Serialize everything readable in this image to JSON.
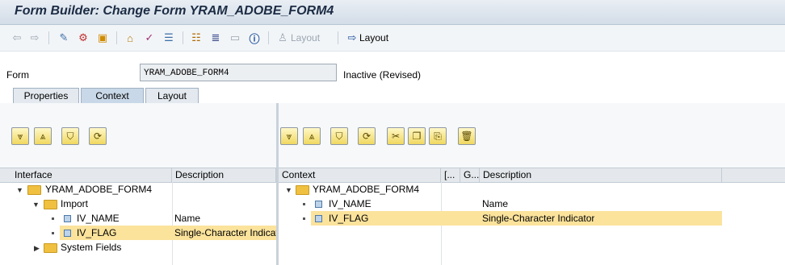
{
  "window": {
    "title": "Form Builder: Change Form YRAM_ADOBE_FORM4"
  },
  "toolbar": {
    "back_icon": "back-arrow-icon",
    "forward_icon": "forward-arrow-icon",
    "layout_disabled_label": "Layout",
    "layout_label": "Layout"
  },
  "form": {
    "label": "Form",
    "value": "YRAM_ADOBE_FORM4",
    "status": "Inactive (Revised)"
  },
  "tabs": [
    {
      "label": "Properties"
    },
    {
      "label": "Context"
    },
    {
      "label": "Layout"
    }
  ],
  "interface_tree": {
    "headers": {
      "name": "Interface",
      "description": "Description"
    },
    "rows": [
      {
        "name": "YRAM_ADOBE_FORM4",
        "description": ""
      },
      {
        "name": "Import",
        "description": ""
      },
      {
        "name": "IV_NAME",
        "description": "Name"
      },
      {
        "name": "IV_FLAG",
        "description": "Single-Character Indicat"
      },
      {
        "name": "System Fields",
        "description": ""
      }
    ]
  },
  "context_tree": {
    "headers": {
      "name": "Context",
      "col2": "[...",
      "col3": "G...",
      "description": "Description"
    },
    "rows": [
      {
        "name": "YRAM_ADOBE_FORM4",
        "description": ""
      },
      {
        "name": "IV_NAME",
        "description": "Name"
      },
      {
        "name": "IV_FLAG",
        "description": "Single-Character Indicator"
      }
    ]
  },
  "colors": {
    "selection": "#fbe39c",
    "title_text": "#1c2c44",
    "tab_active": "#c9d8e8"
  }
}
